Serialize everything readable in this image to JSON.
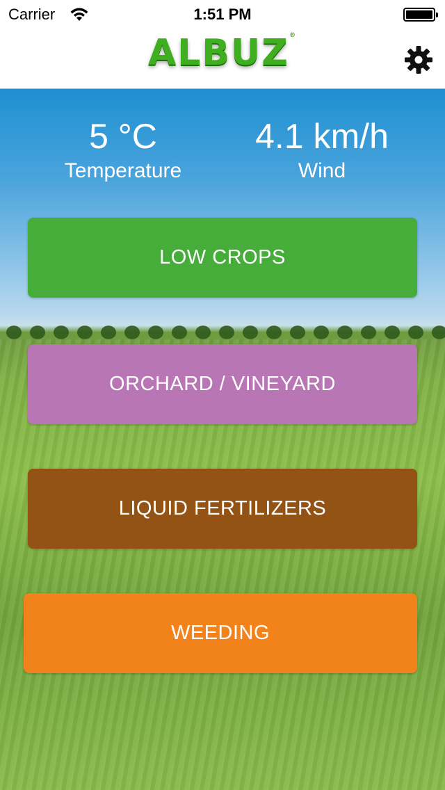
{
  "status_bar": {
    "carrier": "Carrier",
    "time": "1:51 PM",
    "wifi_icon": "wifi-icon",
    "battery_icon": "battery-icon"
  },
  "header": {
    "logo_text": "ALBUZ",
    "logo_mark": "®",
    "logo_color": "#3fae1f",
    "settings_icon": "gear-icon"
  },
  "weather": {
    "temperature": {
      "value": "5 °C",
      "label": "Temperature"
    },
    "wind": {
      "value": "4.1 km/h",
      "label": "Wind"
    }
  },
  "menu": {
    "buttons": [
      {
        "label": "LOW CROPS",
        "color": "#46ad3b"
      },
      {
        "label": "ORCHARD / VINEYARD",
        "color": "#b876b4"
      },
      {
        "label": "LIQUID FERTILIZERS",
        "color": "#935315"
      },
      {
        "label": "WEEDING",
        "color": "#f2821a"
      }
    ]
  }
}
